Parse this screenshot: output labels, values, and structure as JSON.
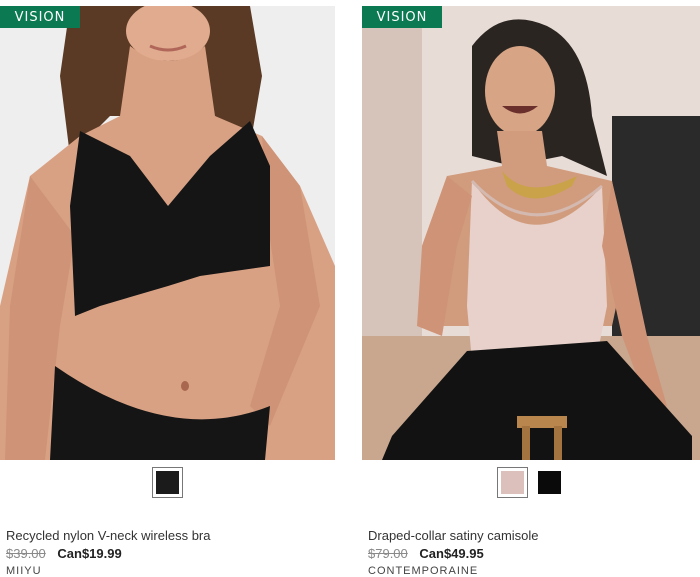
{
  "products": [
    {
      "badge": "VISION",
      "name": "Recycled nylon V-neck wireless bra",
      "old_price": "$39.00",
      "price": "Can$19.99",
      "brand": "MIIYU",
      "swatches": [
        {
          "color": "#1b1b1b",
          "selected": true
        }
      ]
    },
    {
      "badge": "VISION",
      "name": "Draped-collar satiny camisole",
      "old_price": "$79.00",
      "price": "Can$49.95",
      "brand": "CONTEMPORAINE",
      "swatches": [
        {
          "color": "#dcc0bb",
          "selected": true
        },
        {
          "color": "#0a0a0a",
          "selected": false
        }
      ]
    }
  ],
  "colors": {
    "badge_green": "#0b7a52"
  }
}
